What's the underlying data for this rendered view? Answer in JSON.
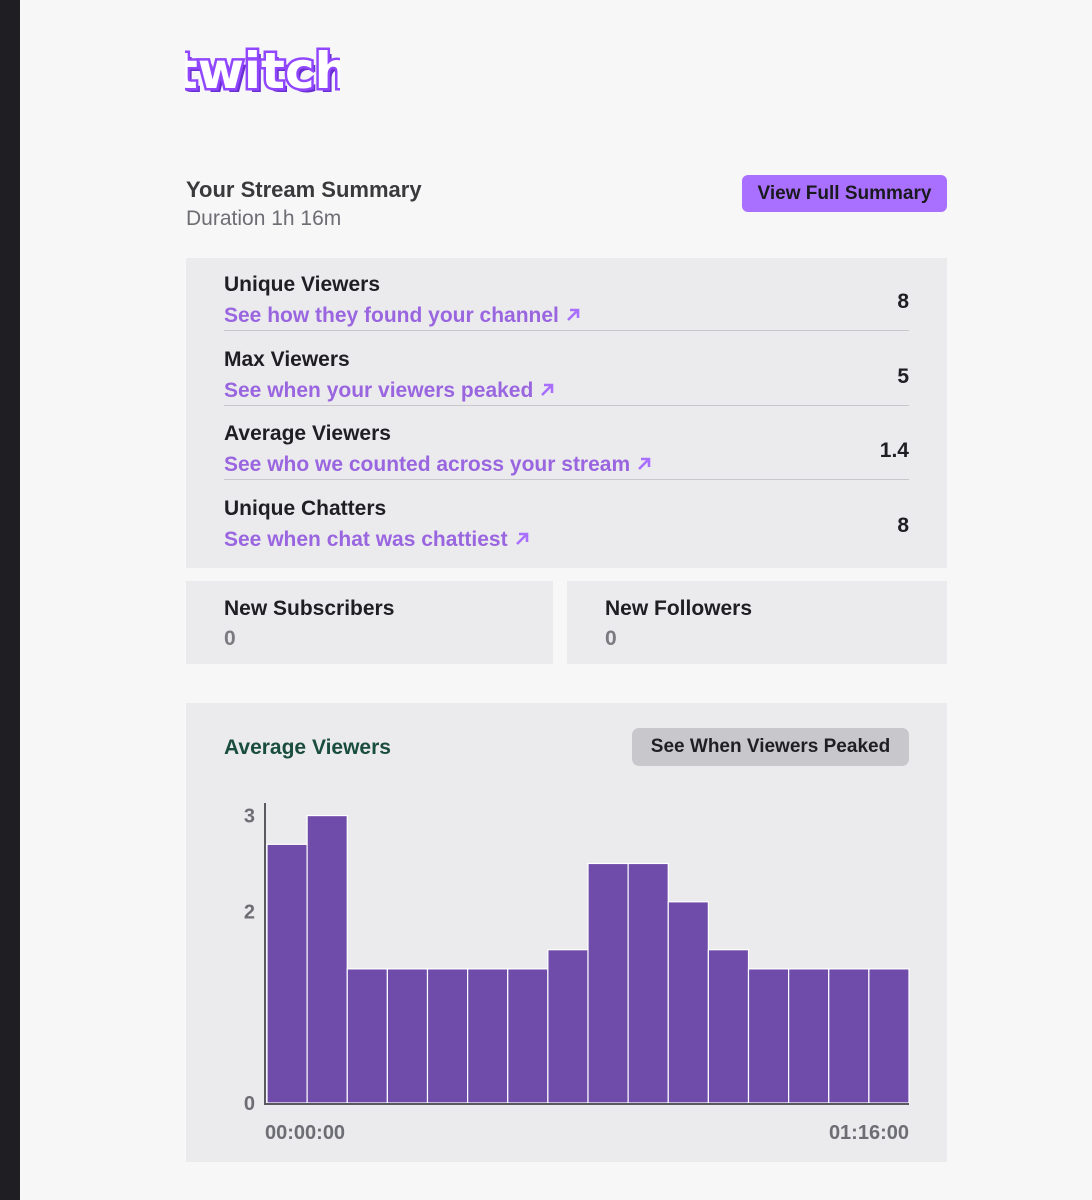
{
  "brand": {
    "logo_text": "twitch",
    "color": "#9147ff"
  },
  "summary": {
    "title": "Your Stream Summary",
    "duration": "Duration 1h 16m",
    "full_summary_button": "View Full Summary"
  },
  "stats": [
    {
      "label": "Unique Viewers",
      "link": "See how they found your channel",
      "value": "8",
      "icon": "arrow-up-right-icon"
    },
    {
      "label": "Max Viewers",
      "link": "See when your viewers peaked",
      "value": "5",
      "icon": "arrow-up-right-icon"
    },
    {
      "label": "Average Viewers",
      "link": "See who we counted across your stream",
      "value": "1.4",
      "icon": "arrow-up-right-icon"
    },
    {
      "label": "Unique Chatters",
      "link": "See when chat was chattiest",
      "value": "8",
      "icon": "arrow-up-right-icon"
    }
  ],
  "subscribers": {
    "label": "New Subscribers",
    "value": "0"
  },
  "followers": {
    "label": "New Followers",
    "value": "0"
  },
  "chart_section": {
    "title": "Average Viewers",
    "button": "See When Viewers Peaked"
  },
  "colors": {
    "accent": "#a970ff",
    "link": "#9a66e0",
    "bar": "#6f4baa",
    "chart_title": "#1a4d3c"
  },
  "chart_data": {
    "type": "bar",
    "title": "Average Viewers",
    "xlabel": "",
    "ylabel": "",
    "x_start_label": "00:00:00",
    "x_end_label": "01:16:00",
    "y_ticks": [
      0,
      2,
      3
    ],
    "ylim": [
      0,
      3.1
    ],
    "grid": false,
    "values": [
      2.7,
      3.0,
      1.4,
      1.4,
      1.4,
      1.4,
      1.4,
      1.6,
      2.5,
      2.5,
      2.1,
      1.6,
      1.4,
      1.4,
      1.4,
      1.4
    ]
  }
}
